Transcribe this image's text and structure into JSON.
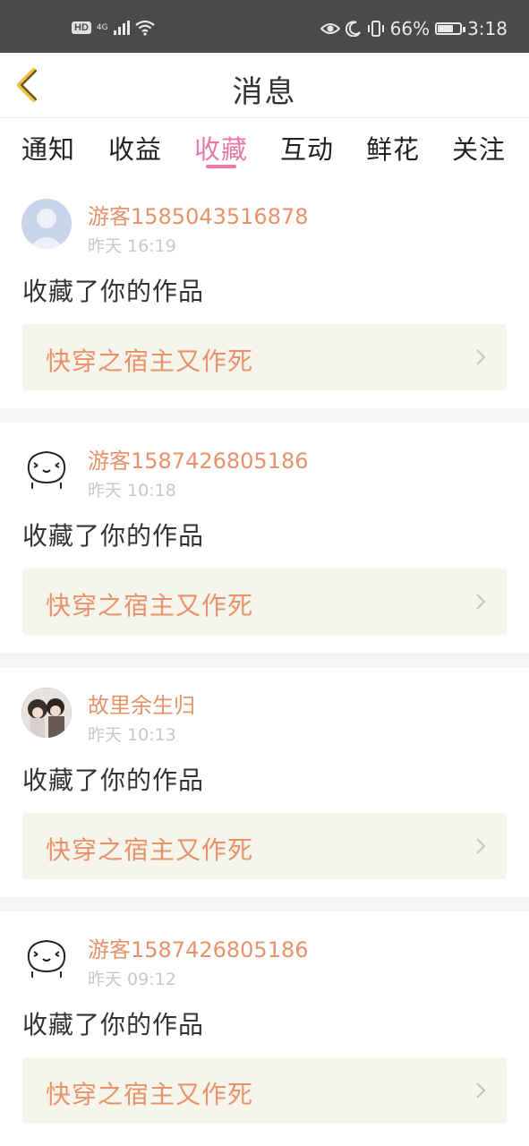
{
  "status_bar": {
    "left_badge": "HD",
    "network": "4G",
    "battery": "66%",
    "battery_level": 0.66,
    "time": "3:18"
  },
  "header": {
    "back_icon": "chevron-left-icon",
    "title": "消息"
  },
  "tabs": [
    {
      "label": "通知"
    },
    {
      "label": "收益"
    },
    {
      "label": "收藏"
    },
    {
      "label": "互动"
    },
    {
      "label": "鲜花"
    },
    {
      "label": "关注"
    }
  ],
  "active_tab": "收藏",
  "colors": {
    "accent_pink": "#e879a9",
    "username_orange": "#e8926a",
    "card_bg": "#f5f5ec"
  },
  "messages": [
    {
      "user": "游客1585043516878",
      "time": "昨天 16:19",
      "action": "收藏了你的作品",
      "work": "快穿之宿主又作死",
      "avatar": "default-avatar-icon"
    },
    {
      "user": "游客1587426805186",
      "time": "昨天 10:18",
      "action": "收藏了你的作品",
      "work": "快穿之宿主又作死",
      "avatar": "cartoon-face-avatar"
    },
    {
      "user": "故里余生归",
      "time": "昨天 10:13",
      "action": "收藏了你的作品",
      "work": "快穿之宿主又作死",
      "avatar": "photo-avatar"
    },
    {
      "user": "游客1587426805186",
      "time": "昨天 09:12",
      "action": "收藏了你的作品",
      "work": "快穿之宿主又作死",
      "avatar": "cartoon-face-avatar"
    }
  ]
}
